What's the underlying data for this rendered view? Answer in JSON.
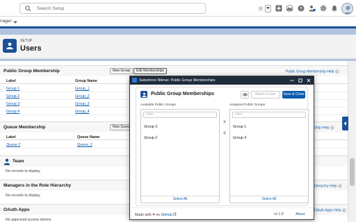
{
  "header": {
    "search_placeholder": "Search Setup",
    "icons": [
      "star-icon",
      "chevron-down-icon",
      "add-icon",
      "trailhead-icon",
      "help-icon",
      "setup-assistant-icon",
      "gear-icon",
      "bell-icon",
      "avatar"
    ]
  },
  "appnav": {
    "app_name": "nager"
  },
  "page": {
    "breadcrumb": "SETUP",
    "title": "Users"
  },
  "sections": {
    "public_groups": {
      "title": "Public Group Membership",
      "new_button": "New Group",
      "edit_button": "Edit Memberships",
      "help": "Public Group Membership Help",
      "columns": [
        "Label",
        "Group Name"
      ],
      "rows": [
        {
          "label": "Group 1",
          "name": "Group_1"
        },
        {
          "label": "Group 2",
          "name": "Group_2"
        },
        {
          "label": "Group 3",
          "name": "Group_3"
        },
        {
          "label": "Group 4",
          "name": "Group_4"
        }
      ]
    },
    "queue": {
      "title": "Queue Membership",
      "new_button": "New Queue",
      "help": "p Membership Help",
      "columns": [
        "Label",
        "Queue Name"
      ],
      "rows": [
        {
          "label": "Queue 2",
          "name": "Queue_2"
        }
      ]
    },
    "team": {
      "title": "Team",
      "empty": "No records to display"
    },
    "managers": {
      "title": "Managers in the Role Hierarchy",
      "help": "hierarchy Help",
      "empty": "No records to display"
    },
    "oauth": {
      "title": "OAuth Apps",
      "help": "OAuth Apps Help",
      "empty": "No approved access tokens"
    }
  },
  "modal": {
    "window_title": "Salesforce Niknax: Public Group Memberships",
    "title": "Public Group Memberships",
    "match_button": "Match a User",
    "save_button": "Save & Close",
    "available": {
      "label": "Available Public Groups",
      "filter_placeholder": "Filter",
      "items": [
        "Group 3",
        "Group 2"
      ],
      "select_all": "Select All"
    },
    "assigned": {
      "label": "Assigned Public Groups",
      "filter_placeholder": "Filter",
      "items": [
        "Group 1",
        "Group 4"
      ],
      "select_all": "Select All"
    },
    "footer": {
      "made_with": "Made with",
      "on": "on",
      "github": "GitHub",
      "version": "v1.1.0",
      "about": "About"
    }
  },
  "colors": {
    "brand": "#1b5297",
    "primary_button": "#0b5cab",
    "titlebar": "#1e2c3d",
    "heart": "#c23934"
  }
}
